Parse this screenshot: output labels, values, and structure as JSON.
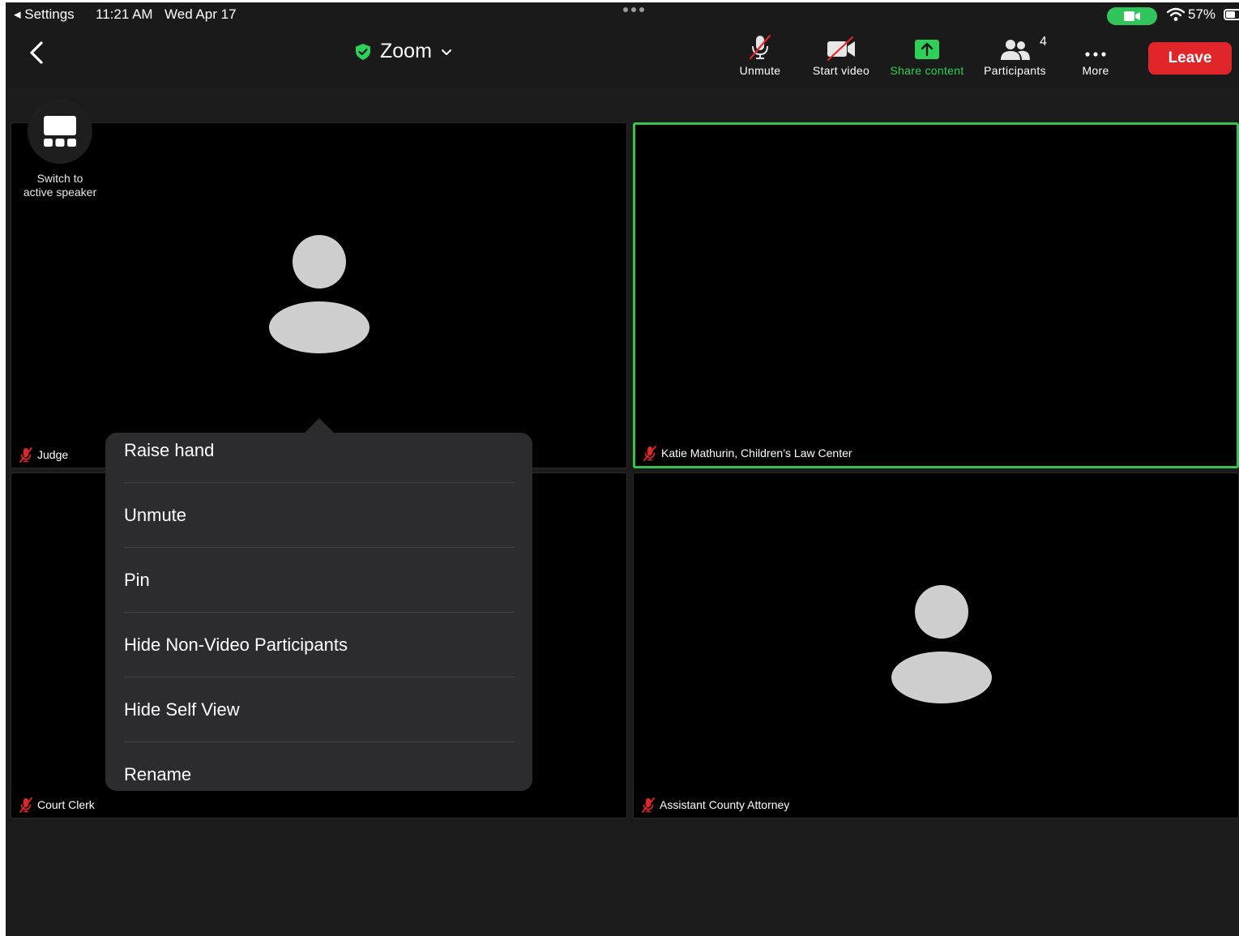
{
  "status_bar": {
    "back_app": "◂ Settings",
    "time": "11:21 AM",
    "date": "Wed Apr 17",
    "battery": "57%"
  },
  "toolbar": {
    "title": "Zoom",
    "unmute_label": "Unmute",
    "start_video_label": "Start video",
    "share_content_label": "Share content",
    "participants_label": "Participants",
    "participants_count": "4",
    "more_label": "More",
    "leave_label": "Leave"
  },
  "switch_speaker": {
    "line1": "Switch to",
    "line2": "active speaker"
  },
  "tiles": [
    {
      "name": "Judge",
      "active": false
    },
    {
      "name": "Katie Mathurin, Children’s Law Center",
      "active": true
    },
    {
      "name": "Court Clerk",
      "active": false
    },
    {
      "name": "Assistant County Attorney",
      "active": false
    }
  ],
  "menu": {
    "items": [
      "Raise hand",
      "Unmute",
      "Pin",
      "Hide Non-Video Participants",
      "Hide Self View",
      "Rename"
    ]
  },
  "colors": {
    "accent_green": "#2dd159",
    "leave_red": "#e0262a",
    "active_border": "#37c24a",
    "muted_mic_red": "#e0262a"
  }
}
